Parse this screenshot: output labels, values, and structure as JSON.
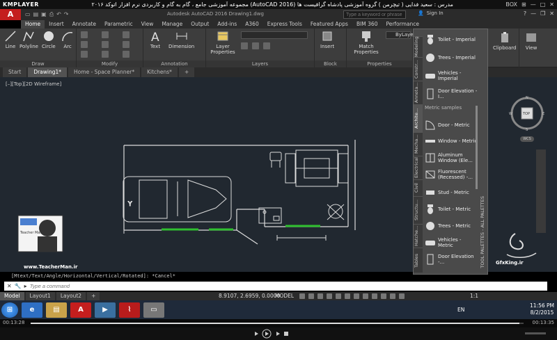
{
  "player": {
    "logo": "KMPLAYER",
    "title": "مجموعه آموزشی جامع ، گام به گام و کاربردی نرم افزار اتوکد ۲۰۱۶ (AutoCAD 2016) مدرس : سعید فدایی ( تیچرمن ) گروه آموزشی پادشاه گرافیست ها",
    "controls": [
      "BOX",
      "⊞",
      "—",
      "□",
      "✕"
    ],
    "time_elapsed": "00:13:28",
    "time_total": "00:13:35",
    "progress": 0.991
  },
  "app": {
    "logo": "A",
    "title": "Autodesk AutoCAD 2016    Drawing1.dwg",
    "search_placeholder": "Type a keyword or phrase",
    "signin": "Sign In"
  },
  "ribbon_tabs": [
    "Home",
    "Insert",
    "Annotate",
    "Parametric",
    "View",
    "Manage",
    "Output",
    "Add-ins",
    "A360",
    "Express Tools",
    "Featured Apps",
    "BIM 360",
    "Performance"
  ],
  "ribbon": {
    "draw": {
      "title": "Draw",
      "line": "Line",
      "polyline": "Polyline",
      "circle": "Circle",
      "arc": "Arc"
    },
    "modify": {
      "title": "Modify"
    },
    "annotation": {
      "title": "Annotation",
      "text": "Text",
      "dimension": "Dimension"
    },
    "layers": {
      "title": "Layers",
      "layer_properties": "Layer Properties"
    },
    "block": {
      "title": "Block",
      "insert": "Insert"
    },
    "properties": {
      "title": "Properties",
      "match_properties": "Match Properties",
      "bylayer": "ByLayer"
    },
    "clipboard": "Clipboard",
    "view": "View"
  },
  "doc_tabs": [
    "Start",
    "Drawing1*",
    "Home - Space Planner*",
    "Kitchens*",
    "+"
  ],
  "view_label": "[–][Top][2D Wireframe]",
  "tool_palette": {
    "vtabs": [
      "Modeling",
      "Constr...",
      "Annota...",
      "Archite...",
      "Mecha...",
      "Electrical",
      "Civil",
      "Structu...",
      "Hatche...",
      "Tables"
    ],
    "vtitle": "TOOL PALETTES - ALL PALETTES",
    "section": "Metric samples",
    "items_imperial": [
      "Toilet - Imperial",
      "Trees - Imperial",
      "Vehicles - Imperial",
      "Door Elevation - I..."
    ],
    "items_metric": [
      "Door - Metric",
      "Window - Metric",
      "Aluminum Window (Ele...",
      "Fluorescent (Recessed) -...",
      "Stud - Metric",
      "Toilet - Metric",
      "Trees - Metric",
      "Vehicles - Metric",
      "Door Elevation -..."
    ]
  },
  "viewcube": {
    "top": "TOP",
    "n": "N",
    "w": "W",
    "e": "E",
    "s": "S",
    "wcs": "WCS"
  },
  "command": {
    "history": "[Mtext/Text/Angle/Horizontal/Vertical/Rotated]: *Cancel*",
    "placeholder": "Type a command"
  },
  "status": {
    "layouts": [
      "Model",
      "Layout1",
      "Layout2",
      "+"
    ],
    "coords": "8.9107, 2.6959, 0.0000",
    "model": "MODEL",
    "scale": "1:1"
  },
  "taskbar": {
    "lang": "EN",
    "time": "11:56 PM",
    "date": "8/2/2015"
  },
  "overlays": {
    "teacher_url": "www.TeacherMan.ir",
    "teacher_name": "Teacher Man",
    "gfx_url": "GfxKing.ir"
  },
  "colors": {
    "autocad_red": "#c41e1e",
    "canvas": "#212830",
    "window_green": "#2fbf2f",
    "ribbon": "#3d3d3d"
  }
}
